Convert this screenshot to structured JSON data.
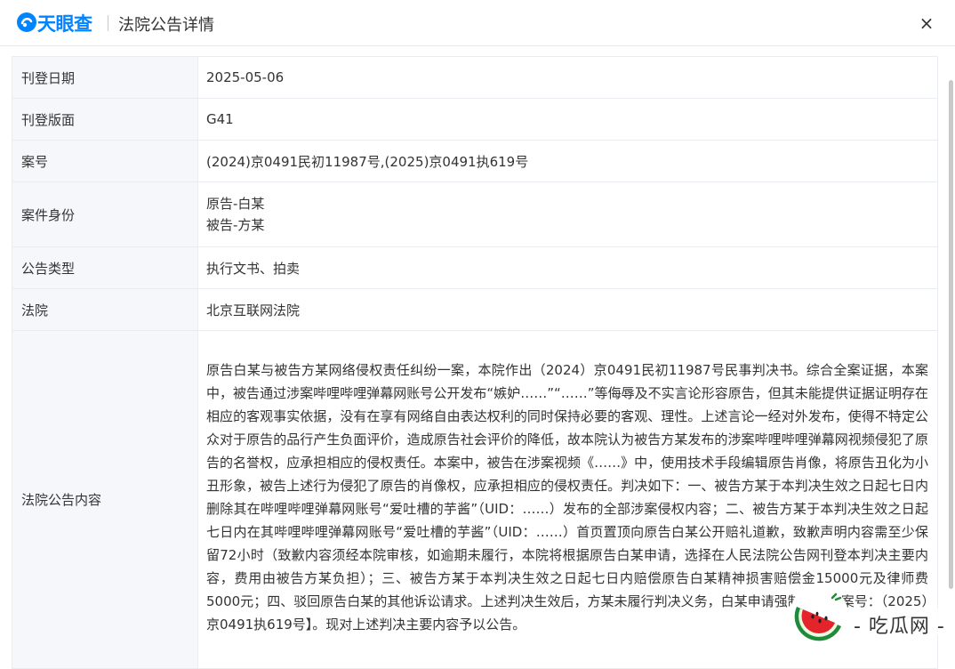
{
  "header": {
    "logo_text": "天眼查",
    "title": "法院公告详情",
    "close_label": "×"
  },
  "rows": {
    "publish_date": {
      "label": "刊登日期",
      "value": "2025-05-06"
    },
    "publish_page": {
      "label": "刊登版面",
      "value": "G41"
    },
    "case_number": {
      "label": "案号",
      "value": "(2024)京0491民初11987号,(2025)京0491执619号"
    },
    "parties": {
      "label": "案件身份",
      "plaintiff": "原告-白某",
      "defendant": "被告-方某"
    },
    "notice_type": {
      "label": "公告类型",
      "value": "执行文书、拍卖"
    },
    "court": {
      "label": "法院",
      "value": "北京互联网法院"
    },
    "notice_content": {
      "label": "法院公告内容",
      "value": "原告白某与被告方某网络侵权责任纠纷一案，本院作出（2024）京0491民初11987号民事判决书。综合全案证据，本案中，被告通过涉案哔哩哔哩弹幕网账号公开发布“嫉妒……”“……”等侮辱及不实言论形容原告，但其未能提供证据证明存在相应的客观事实依据，没有在享有网络自由表达权利的同时保持必要的客观、理性。上述言论一经对外发布，使得不特定公众对于原告的品行产生负面评价，造成原告社会评价的降低，故本院认为被告方某发布的涉案哔哩哔哩弹幕网视频侵犯了原告的名誉权，应承担相应的侵权责任。本案中，被告在涉案视频《……》中，使用技术手段编辑原告肖像，将原告丑化为小丑形象，被告上述行为侵犯了原告的肖像权，应承担相应的侵权责任。判决如下：一、被告方某于本判决生效之日起七日内删除其在哔哩哔哩弹幕网账号“爱吐槽的芋酱”（UID：……）发布的全部涉案侵权内容；二、被告方某于本判决生效之日起七日内在其哔哩哔哩弹幕网账号“爱吐槽的芋酱”（UID：……）首页置顶向原告白某公开赔礼道歉，致歉声明内容需至少保留72小时（致歉内容须经本院审核，如逾期未履行，本院将根据原告白某申请，选择在人民法院公告网刊登本判决主要内容，费用由被告方某负担）；三、被告方某于本判决生效之日起七日内赔偿原告白某精神损害赔偿金15000元及律师费5000元；四、驳回原告白某的其他诉讼请求。上述判决生效后，方某未履行判决义务，白某申请强制执行【案号：（2025）京0491执619号】。现对上述判决主要内容予以公告。"
    }
  },
  "watermark": {
    "text": "- 吃瓜网 -"
  },
  "colors": {
    "brand": "#0084ff",
    "label_bg": "#f5f7fa",
    "border": "#e9ecf0"
  }
}
